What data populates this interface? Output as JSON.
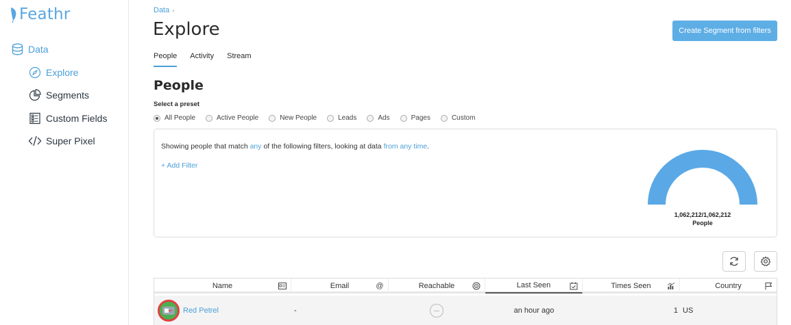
{
  "app": {
    "logo_text": "Feathr"
  },
  "sidebar": {
    "data_label": "Data",
    "items": [
      {
        "label": "Explore",
        "icon": "compass-icon",
        "active": true
      },
      {
        "label": "Segments",
        "icon": "pie-chart-icon",
        "active": false
      },
      {
        "label": "Custom Fields",
        "icon": "list-icon",
        "active": false
      },
      {
        "label": "Super Pixel",
        "icon": "code-icon",
        "active": false
      }
    ]
  },
  "header": {
    "breadcrumb": "Data",
    "title": "Explore",
    "create_button": "Create Segment from filters"
  },
  "tabs": [
    {
      "label": "People",
      "active": true
    },
    {
      "label": "Activity",
      "active": false
    },
    {
      "label": "Stream",
      "active": false
    }
  ],
  "people": {
    "title": "People",
    "preset_label": "Select a preset",
    "presets": [
      {
        "label": "All People",
        "checked": true
      },
      {
        "label": "Active People",
        "checked": false
      },
      {
        "label": "New People",
        "checked": false
      },
      {
        "label": "Leads",
        "checked": false
      },
      {
        "label": "Ads",
        "checked": false
      },
      {
        "label": "Pages",
        "checked": false
      },
      {
        "label": "Custom",
        "checked": false
      }
    ]
  },
  "filters": {
    "text_prefix": "Showing people that match ",
    "match_link": "any",
    "text_middle": " of the following filters, looking at data ",
    "time_link": "from any time",
    "text_suffix": ".",
    "add_filter": "+ Add Filter"
  },
  "gauge": {
    "count": "1,062,212/1,062,212",
    "unit": "People",
    "fraction": 1.0,
    "color": "#5aa9e6"
  },
  "table": {
    "columns": [
      {
        "label": "Name",
        "icon": "id-card-icon"
      },
      {
        "label": "Email",
        "icon": "at-sign-icon"
      },
      {
        "label": "Reachable",
        "icon": "target-icon"
      },
      {
        "label": "Last Seen",
        "icon": "calendar-check-icon",
        "sorted": true
      },
      {
        "label": "Times Seen",
        "icon": "bar-chart-icon"
      },
      {
        "label": "Country",
        "icon": "flag-icon"
      }
    ],
    "rows": [
      {
        "name": "Red Petrel",
        "email": "-",
        "last_seen": "an hour ago",
        "times_seen": "1",
        "country": "US"
      }
    ]
  }
}
